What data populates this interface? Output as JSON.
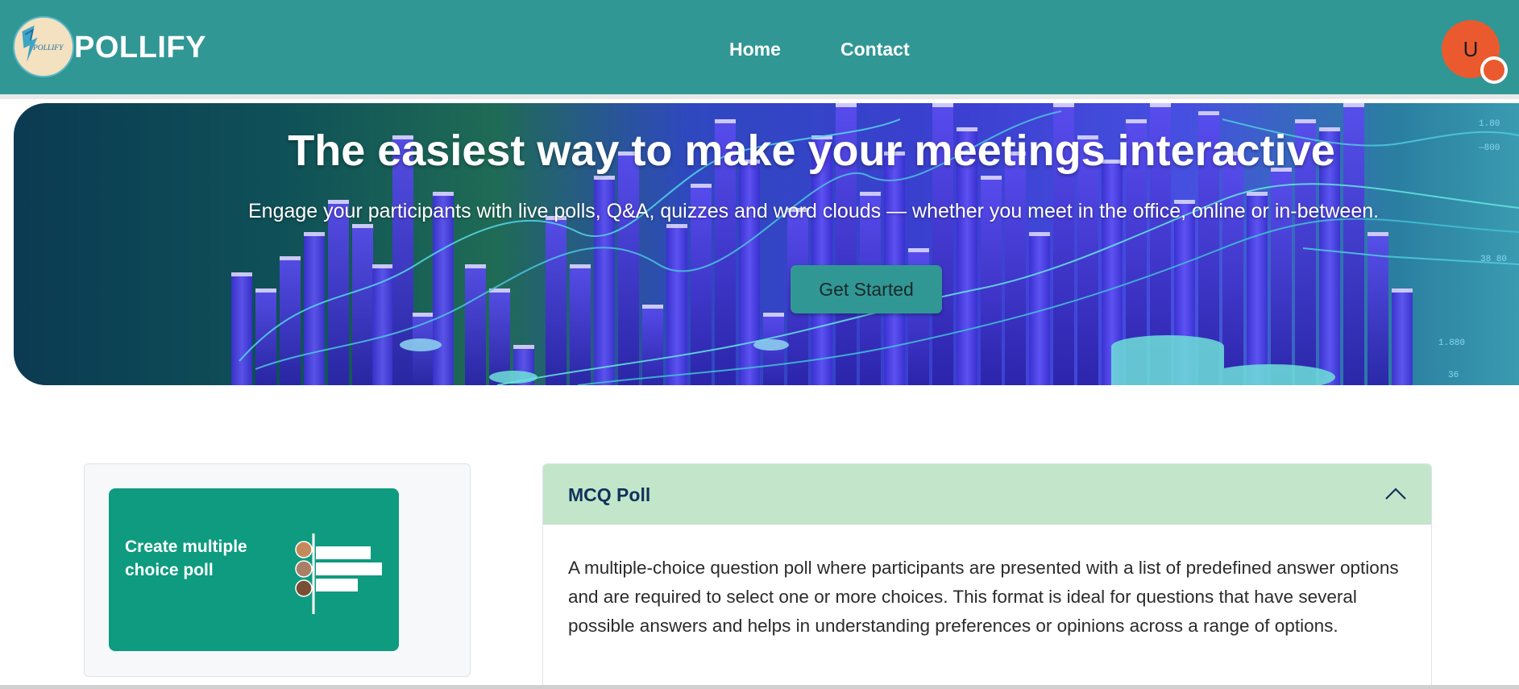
{
  "navbar": {
    "logo_text": "POLLIFY",
    "brand": "POLLIFY",
    "links": [
      {
        "label": "Home"
      },
      {
        "label": "Contact"
      }
    ],
    "avatar_initial": "U",
    "bg_color": "#319795"
  },
  "hero": {
    "title": "The easiest way to make your meetings interactive",
    "subtitle": "Engage your participants with live polls, Q&A, quizzes and word clouds — whether you meet in the office, online or in-between.",
    "cta_label": "Get Started"
  },
  "card": {
    "tile_text": "Create multiple choice poll",
    "tile_color": "#0e9b7f"
  },
  "accordion": {
    "title": "MCQ Poll",
    "expanded": true,
    "body": "A multiple-choice question poll where participants are presented with a list of predefined answer options and are required to select one or more choices. This format is ideal for questions that have several possible answers and helps in understanding preferences or opinions across a range of options.",
    "header_color": "#c3e6cb"
  }
}
